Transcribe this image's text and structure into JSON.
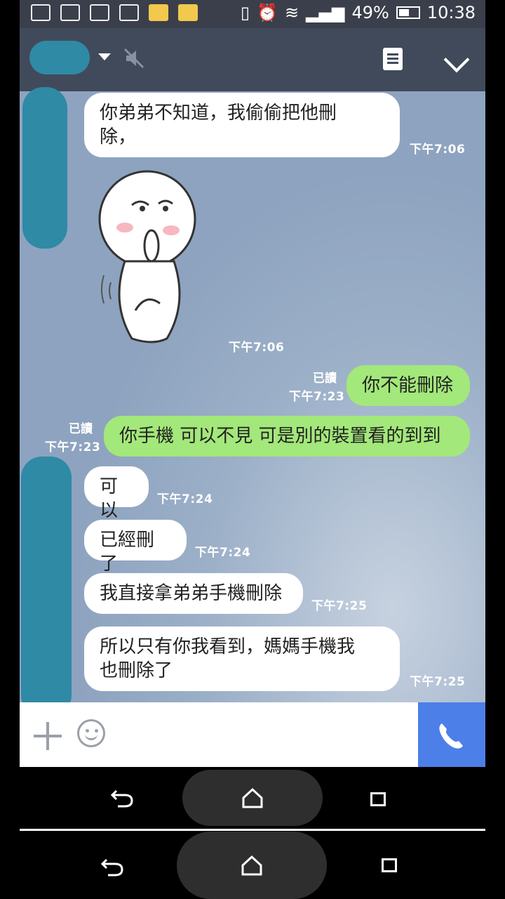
{
  "status_bar": {
    "battery": "49%",
    "time": "10:38"
  },
  "header": {
    "mute": true
  },
  "messages": [
    {
      "side": "left",
      "text_l1": "你弟弟不知道，我偷偷把他刪",
      "text_l2": "除，",
      "time": "下午7:06"
    },
    {
      "side": "left",
      "type": "sticker",
      "time": "下午7:06"
    },
    {
      "side": "right",
      "text": "你不能刪除",
      "read": "已讀",
      "time": "下午7:23"
    },
    {
      "side": "right",
      "text": "你手機 可以不見 可是別的裝置看的到到",
      "read": "已讀",
      "time": "下午7:23"
    },
    {
      "side": "left",
      "text": "可以",
      "time": "下午7:24"
    },
    {
      "side": "left",
      "text": "已經刪了",
      "time": "下午7:24"
    },
    {
      "side": "left",
      "text": "我直接拿弟弟手機刪除",
      "time": "下午7:25"
    },
    {
      "side": "left",
      "text_l1": "所以只有你我看到，媽媽手機我",
      "text_l2": "也刪除了",
      "time": "下午7:25"
    }
  ],
  "input": {
    "placeholder": ""
  },
  "icons": {
    "plus": "plus-icon",
    "emoji": "emoji-icon",
    "call": "phone-icon",
    "menu": "note-icon",
    "collapse": "chevron-down-icon",
    "back": "back-icon",
    "home": "home-icon",
    "recent": "recent-apps-icon"
  },
  "colors": {
    "header": "#414a5b",
    "my_bubble": "#a3e87a",
    "call": "#4d7fe8"
  }
}
